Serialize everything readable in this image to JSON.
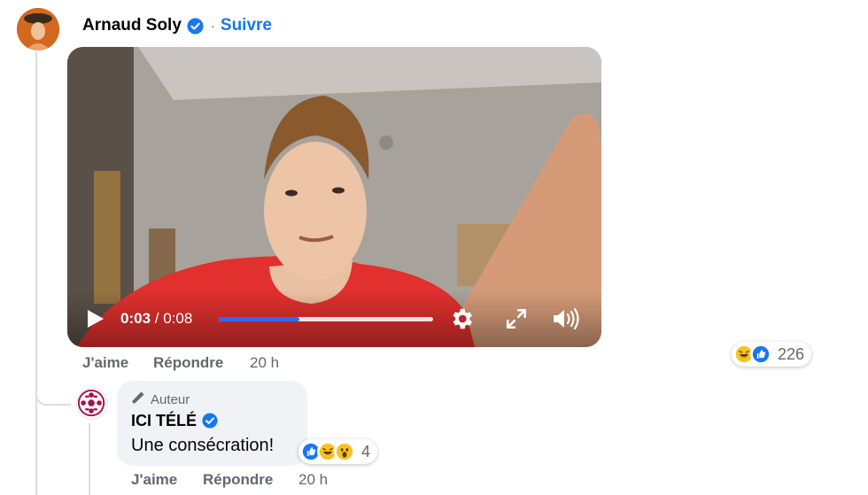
{
  "post": {
    "author_name": "Arnaud Soly",
    "separator": "·",
    "follow_label": "Suivre"
  },
  "video": {
    "current_time": "0:03",
    "time_separator": "/",
    "duration": "0:08",
    "progress_fraction": 0.375
  },
  "post_actions": {
    "like_label": "J'aime",
    "reply_label": "Répondre",
    "timestamp": "20 h"
  },
  "post_reactions": {
    "icons": [
      "haha-icon",
      "like-icon"
    ],
    "count": "226"
  },
  "comment": {
    "badge_label": "Auteur",
    "author_name": "ICI TÉLÉ",
    "text": "Une consécration!",
    "reactions": {
      "icons": [
        "like-icon",
        "haha-icon",
        "wow-icon"
      ],
      "count": "4"
    },
    "actions": {
      "like_label": "J'aime",
      "reply_label": "Répondre",
      "timestamp": "20 h"
    }
  },
  "colors": {
    "accent": "#1877f2",
    "progress": "#2d6bf2",
    "secondary_text": "#65676b",
    "bubble": "#f0f2f5",
    "ici_brand": "#a50f4f"
  }
}
